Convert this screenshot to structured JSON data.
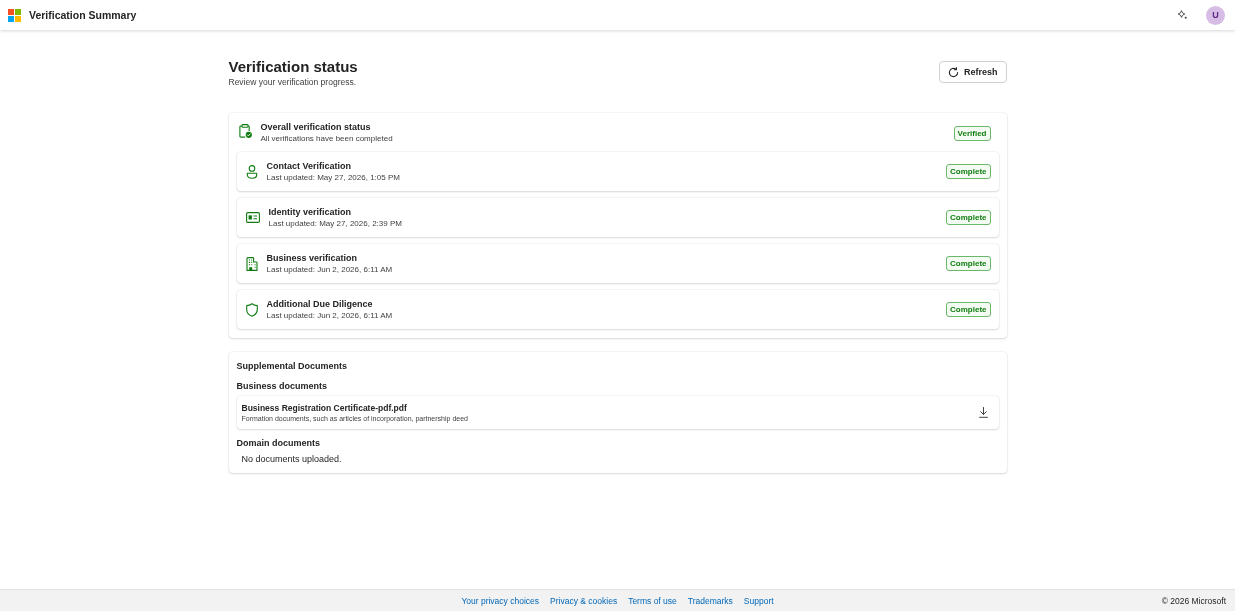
{
  "header": {
    "title": "Verification Summary",
    "avatar": "U"
  },
  "page": {
    "title": "Verification status",
    "subtitle": "Review your verification progress.",
    "refresh_button": "Refresh"
  },
  "overall": {
    "title": "Overall verification status",
    "subtitle": "All verifications have been completed",
    "badge": "Verified"
  },
  "verifications": [
    {
      "kind": "contact",
      "title": "Contact Verification",
      "updated": "Last updated: May 27, 2026, 1:05 PM",
      "badge": "Complete"
    },
    {
      "kind": "identity",
      "title": "Identity verification",
      "updated": "Last updated: May 27, 2026, 2:39 PM",
      "badge": "Complete"
    },
    {
      "kind": "business",
      "title": "Business verification",
      "updated": "Last updated: Jun 2, 2026, 6:11 AM",
      "badge": "Complete"
    },
    {
      "kind": "diligence",
      "title": "Additional Due Diligence",
      "updated": "Last updated: Jun 2, 2026, 6:11 AM",
      "badge": "Complete"
    }
  ],
  "supplemental": {
    "title": "Supplemental Documents",
    "sections": [
      {
        "title": "Business documents",
        "documents": [
          {
            "name": "Business Registration Certificate-pdf.pdf",
            "description": "Formation documents, such as articles of incorporation, partnership deed"
          }
        ]
      },
      {
        "title": "Domain documents",
        "empty_text": "No documents uploaded."
      }
    ]
  },
  "footer": {
    "links": [
      "Your privacy choices",
      "Privacy & cookies",
      "Terms of use",
      "Trademarks",
      "Support"
    ],
    "copyright": "© 2026 Microsoft"
  }
}
